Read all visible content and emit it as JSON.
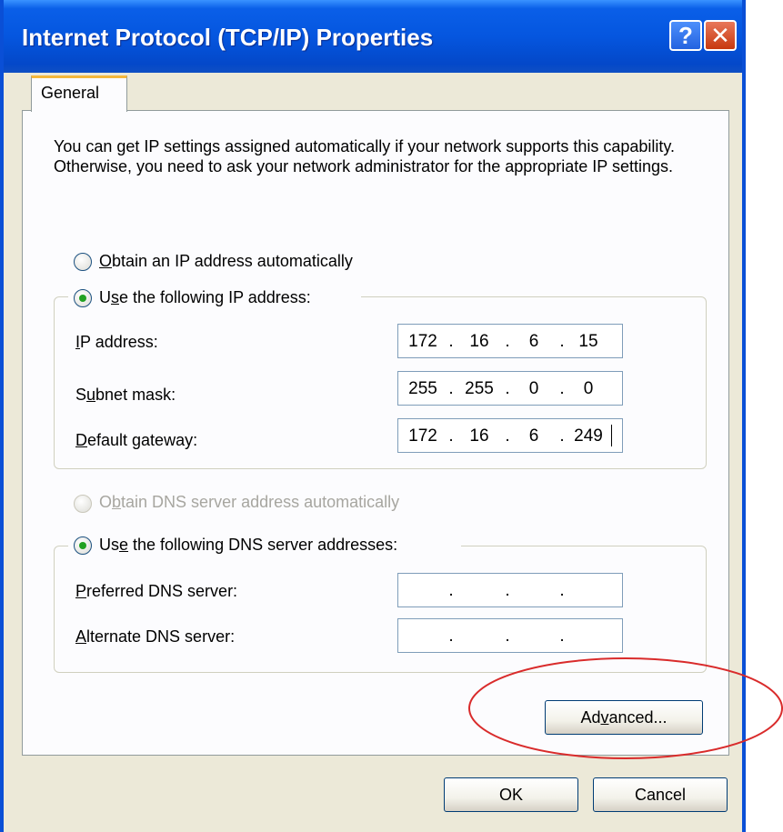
{
  "window": {
    "title": "Internet Protocol (TCP/IP) Properties",
    "help_glyph": "?",
    "close_glyph": "✕",
    "accent_color": "#0556df"
  },
  "tabs": [
    {
      "label": "General",
      "selected": true
    }
  ],
  "description": "You can get IP settings assigned automatically if your network supports this capability. Otherwise, you need to ask your network administrator for the appropriate IP settings.",
  "ip_mode": {
    "auto": {
      "label_u": "O",
      "label_rest": "btain an IP address automatically",
      "checked": false
    },
    "manual": {
      "label_pre": "U",
      "label_u": "s",
      "label_rest": "e the following IP address:",
      "checked": true
    }
  },
  "ip_fields": {
    "ip_address": {
      "label_u": "I",
      "label_rest": "P address:",
      "octets": [
        "172",
        "16",
        "6",
        "15"
      ]
    },
    "subnet_mask": {
      "label_pre": "S",
      "label_u": "u",
      "label_rest": "bnet mask:",
      "octets": [
        "255",
        "255",
        "0",
        "0"
      ]
    },
    "default_gateway": {
      "label_u": "D",
      "label_rest": "efault gateway:",
      "octets": [
        "172",
        "16",
        "6",
        "249"
      ]
    }
  },
  "dns_mode": {
    "auto": {
      "label_pre": "O",
      "label_u": "b",
      "label_rest": "tain DNS server address automatically",
      "checked": false,
      "disabled": true
    },
    "manual": {
      "label_pre": "Us",
      "label_u": "e",
      "label_rest": " the following DNS server addresses:",
      "checked": true
    }
  },
  "dns_fields": {
    "preferred": {
      "label_u": "P",
      "label_rest": "referred DNS server:",
      "octets": [
        "",
        "",
        "",
        ""
      ]
    },
    "alternate": {
      "label_u": "A",
      "label_rest": "lternate DNS server:",
      "octets": [
        "",
        "",
        "",
        ""
      ]
    }
  },
  "buttons": {
    "advanced": {
      "pre": "Ad",
      "u": "v",
      "rest": "anced..."
    },
    "ok": "OK",
    "cancel": "Cancel"
  },
  "annotation_color": "#d92b2b"
}
